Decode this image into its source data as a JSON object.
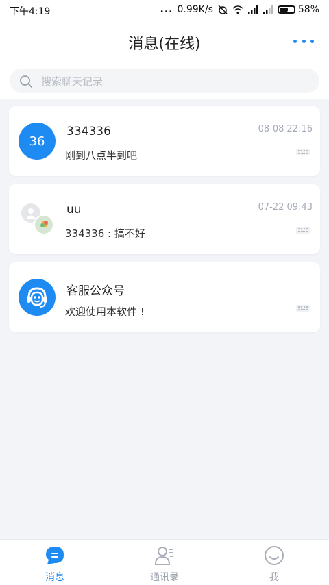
{
  "status_bar": {
    "time": "下午4:19",
    "dots": "...",
    "speed": "0.99K/s",
    "battery": "58%",
    "battery_level": 0.58
  },
  "header": {
    "title": "消息(在线)",
    "more_icon": "more-dots-icon"
  },
  "search": {
    "placeholder": "搜索聊天记录",
    "icon": "search-icon"
  },
  "conversations": [
    {
      "avatar_text": "36",
      "name": "334336",
      "preview": "刚到八点半到吧",
      "time": "08-08 22:16",
      "avatar_type": "number",
      "avatar_color": "#1E8BF3"
    },
    {
      "avatar_text": "",
      "name": "uu",
      "preview": "334336 : 搞不好",
      "time": "07-22 09:43",
      "avatar_type": "group-avatar-icon"
    },
    {
      "avatar_text": "",
      "name": "客服公众号",
      "preview": "欢迎使用本软件 !",
      "time": "",
      "avatar_type": "customer-service-icon",
      "avatar_color": "#1E8BF3"
    }
  ],
  "bottom_nav": [
    {
      "label": "消息",
      "icon": "chat-bubble-icon",
      "active": true
    },
    {
      "label": "通讯录",
      "icon": "contacts-icon",
      "active": false
    },
    {
      "label": "我",
      "icon": "smiley-face-icon",
      "active": false
    }
  ],
  "colors": {
    "accent": "#1E8BF3",
    "background": "#F2F4F8",
    "muted_text": "#A4ABB5"
  }
}
